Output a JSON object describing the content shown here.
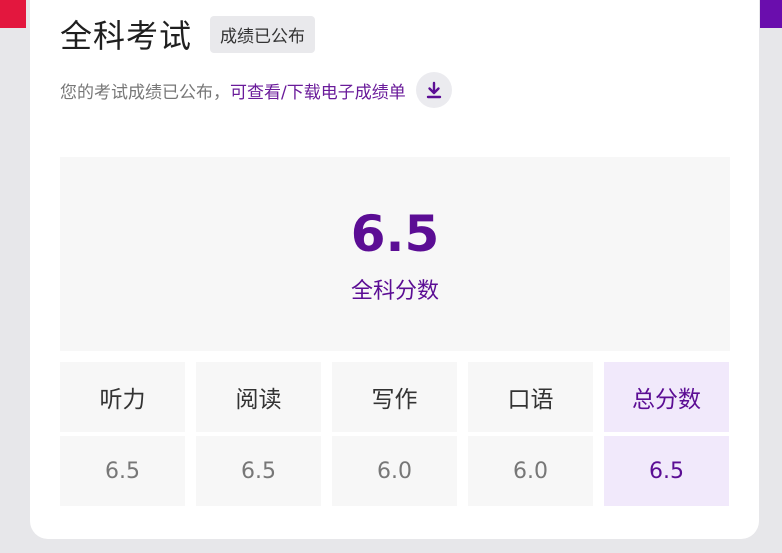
{
  "header": {
    "title": "全科考试",
    "badge": "成绩已公布"
  },
  "notice": {
    "text": "您的考试成绩已公布，",
    "link": "可查看/下载电子成绩单",
    "download_icon": "download-icon"
  },
  "overall": {
    "score": "6.5",
    "label": "全科分数"
  },
  "sections": [
    {
      "name": "听力",
      "score": "6.5"
    },
    {
      "name": "阅读",
      "score": "6.5"
    },
    {
      "name": "写作",
      "score": "6.0"
    },
    {
      "name": "口语",
      "score": "6.0"
    },
    {
      "name": "总分数",
      "score": "6.5"
    }
  ],
  "colors": {
    "accent_red": "#e3173e",
    "accent_purple": "#6a0dad",
    "score_purple": "#5b0d94",
    "highlight_bg": "#f1e9fb"
  }
}
